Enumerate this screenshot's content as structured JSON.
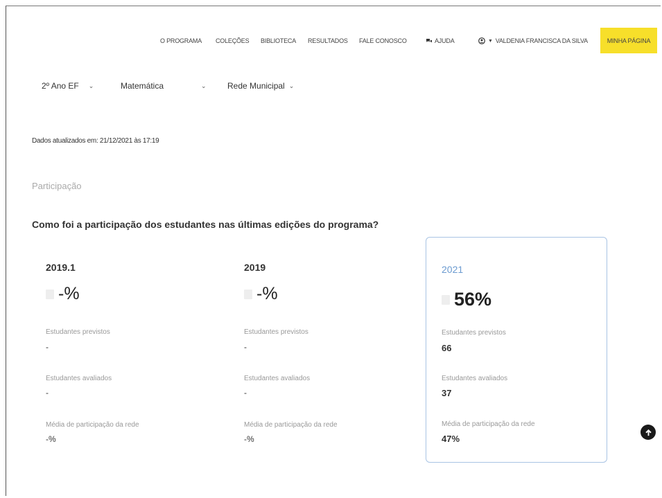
{
  "nav": {
    "items": [
      "O PROGRAMA",
      "COLEÇÕES",
      "BIBLIOTECA",
      "RESULTADOS",
      "FALE CONOSCO"
    ],
    "help_label": "AJUDA",
    "user_name": "VALDENIA FRANCISCA DA SILVA",
    "my_page_label": "MINHA PÁGINA",
    "accent_color": "#f7df2a"
  },
  "filters": {
    "grade": "2º Ano EF",
    "subject": "Matemática",
    "network": "Rede Municipal"
  },
  "updated_text": "Dados atualizados em: 21/12/2021 às 17:19",
  "section_label": "Participação",
  "question": "Como foi a participação dos estudantes nas últimas edições do programa?",
  "cards": [
    {
      "year": "2019.1",
      "percent": "-%",
      "expected_label": "Estudantes previstos",
      "expected_value": "-",
      "evaluated_label": "Estudantes avaliados",
      "evaluated_value": "-",
      "network_avg_label": "Média de participação da rede",
      "network_avg_value": "-%"
    },
    {
      "year": "2019",
      "percent": "-%",
      "expected_label": "Estudantes previstos",
      "expected_value": "-",
      "evaluated_label": "Estudantes avaliados",
      "evaluated_value": "-",
      "network_avg_label": "Média de participação da rede",
      "network_avg_value": "-%"
    },
    {
      "year": "2021",
      "percent": "56%",
      "expected_label": "Estudantes previstos",
      "expected_value": "66",
      "evaluated_label": "Estudantes avaliados",
      "evaluated_value": "37",
      "network_avg_label": "Média de participação da rede",
      "network_avg_value": "47%"
    }
  ]
}
